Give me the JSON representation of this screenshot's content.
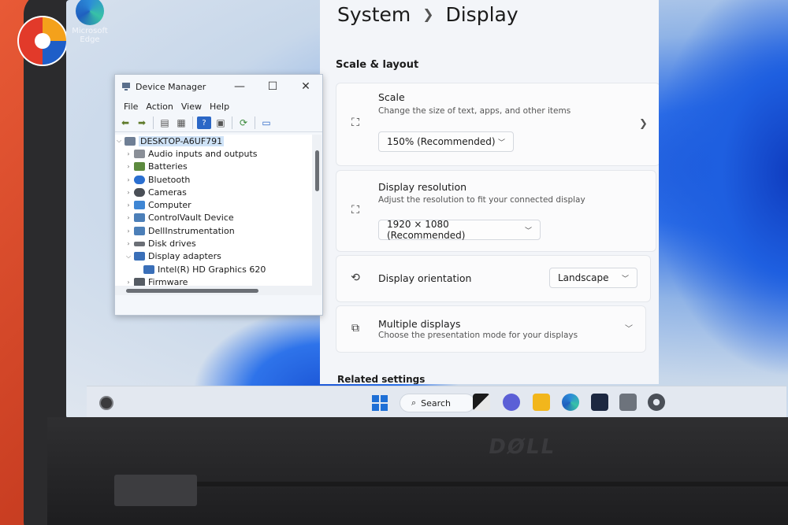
{
  "desktop": {
    "edge_icon_label_line1": "Microsoft",
    "edge_icon_label_line2": "Edge"
  },
  "device_manager": {
    "title": "Device Manager",
    "menu": [
      "File",
      "Action",
      "View",
      "Help"
    ],
    "tree": [
      {
        "label": "DESKTOP-A6UF791",
        "level": 0,
        "expanded": true,
        "icon": "computer-root-icon"
      },
      {
        "label": "Audio inputs and outputs",
        "level": 1,
        "expanded": false,
        "icon": "speaker-icon"
      },
      {
        "label": "Batteries",
        "level": 1,
        "expanded": false,
        "icon": "battery-icon"
      },
      {
        "label": "Bluetooth",
        "level": 1,
        "expanded": false,
        "icon": "bluetooth-icon"
      },
      {
        "label": "Cameras",
        "level": 1,
        "expanded": false,
        "icon": "camera-icon"
      },
      {
        "label": "Computer",
        "level": 1,
        "expanded": false,
        "icon": "monitor-icon"
      },
      {
        "label": "ControlVault Device",
        "level": 1,
        "expanded": false,
        "icon": "device-icon"
      },
      {
        "label": "DellInstrumentation",
        "level": 1,
        "expanded": false,
        "icon": "device-icon"
      },
      {
        "label": "Disk drives",
        "level": 1,
        "expanded": false,
        "icon": "disk-icon"
      },
      {
        "label": "Display adapters",
        "level": 1,
        "expanded": true,
        "icon": "display-adapter-icon"
      },
      {
        "label": "Intel(R) HD Graphics 620",
        "level": 2,
        "expanded": null,
        "icon": "display-adapter-icon"
      },
      {
        "label": "Firmware",
        "level": 1,
        "expanded": false,
        "icon": "firmware-icon"
      }
    ]
  },
  "settings": {
    "breadcrumb_parent": "System",
    "breadcrumb_current": "Display",
    "section_heading": "Scale & layout",
    "scale": {
      "title": "Scale",
      "description": "Change the size of text, apps, and other items",
      "value": "150% (Recommended)"
    },
    "resolution": {
      "title": "Display resolution",
      "description": "Adjust the resolution to fit your connected display",
      "value": "1920 × 1080 (Recommended)"
    },
    "orientation": {
      "title": "Display orientation",
      "value": "Landscape"
    },
    "multiple_displays": {
      "title": "Multiple displays",
      "description": "Choose the presentation mode for your displays"
    },
    "related_heading": "Related settings"
  },
  "taskbar": {
    "search_label": "Search"
  },
  "bezel": {
    "brand": "DØLL"
  },
  "colors": {
    "accent": "#1e6fd6",
    "table_red": "#c93e22"
  }
}
